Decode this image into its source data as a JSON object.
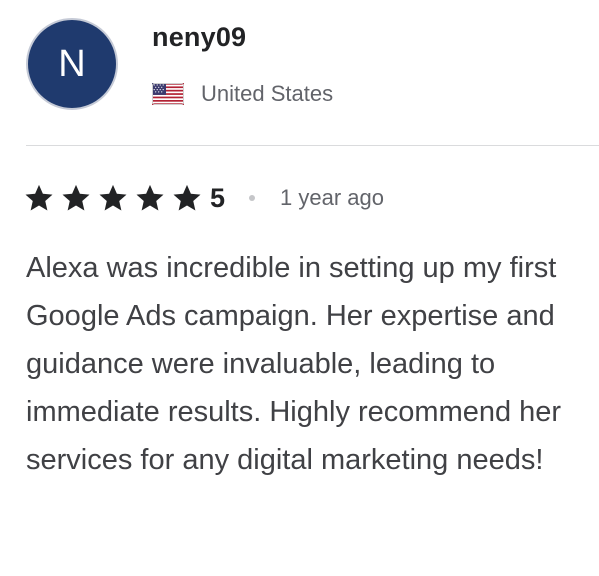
{
  "reviewer": {
    "avatar_letter": "N",
    "username": "neny09",
    "country": "United States",
    "flag_icon": "us-flag-icon"
  },
  "rating": {
    "stars": 5,
    "value": "5",
    "star_icon": "star-icon",
    "time_ago": "1 year ago"
  },
  "review": {
    "text": "Alexa was incredible in setting up my first Google Ads campaign. Her expertise and guidance were invaluable, leading to immediate results. Highly recommend her services for any digital marketing needs!"
  },
  "colors": {
    "avatar_bg": "#1f3a6e",
    "text_primary": "#222325",
    "text_secondary": "#62646a",
    "review_text": "#404145",
    "divider": "#dadbdd"
  }
}
